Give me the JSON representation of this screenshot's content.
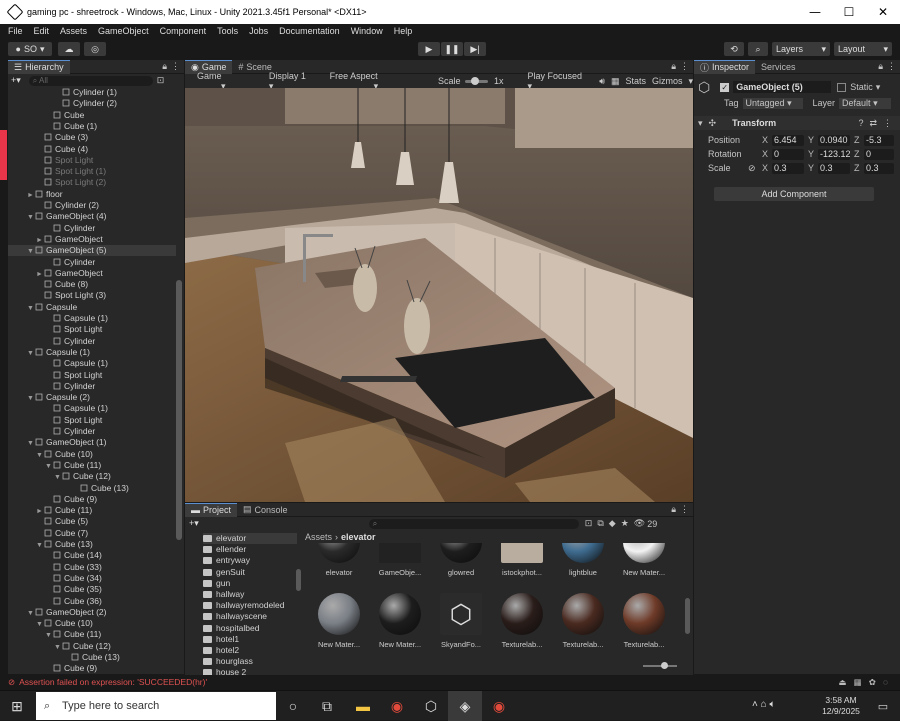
{
  "window": {
    "title": "gaming pc - shreetrock - Windows, Mac, Linux - Unity 2021.3.45f1 Personal* <DX11>",
    "min": "—",
    "max": "☐",
    "close": "✕"
  },
  "menu": [
    "File",
    "Edit",
    "Assets",
    "GameObject",
    "Component",
    "Tools",
    "Jobs",
    "Documentation",
    "Window",
    "Help"
  ],
  "toolbar": {
    "account": "SO",
    "layers": "Layers",
    "layout": "Layout"
  },
  "hierarchy": {
    "tab": "Hierarchy",
    "search_placeholder": "All",
    "rows": [
      {
        "t": "Cylinder (1)",
        "i": 5,
        "a": ""
      },
      {
        "t": "Cylinder (2)",
        "i": 5,
        "a": ""
      },
      {
        "t": "Cube",
        "i": 4,
        "a": ""
      },
      {
        "t": "Cube (1)",
        "i": 4,
        "a": ""
      },
      {
        "t": "Cube (3)",
        "i": 3,
        "a": ""
      },
      {
        "t": "Cube (4)",
        "i": 3,
        "a": ""
      },
      {
        "t": "Spot Light",
        "i": 3,
        "a": "",
        "d": 1
      },
      {
        "t": "Spot Light (1)",
        "i": 3,
        "a": "",
        "d": 1
      },
      {
        "t": "Spot Light (2)",
        "i": 3,
        "a": "",
        "d": 1
      },
      {
        "t": "floor",
        "i": 2,
        "a": "►"
      },
      {
        "t": "Cylinder (2)",
        "i": 3,
        "a": ""
      },
      {
        "t": "GameObject (4)",
        "i": 2,
        "a": "▼"
      },
      {
        "t": "Cylinder",
        "i": 4,
        "a": ""
      },
      {
        "t": "GameObject",
        "i": 3,
        "a": "►"
      },
      {
        "t": "GameObject (5)",
        "i": 2,
        "a": "▼",
        "s": 1
      },
      {
        "t": "Cylinder",
        "i": 4,
        "a": ""
      },
      {
        "t": "GameObject",
        "i": 3,
        "a": "►"
      },
      {
        "t": "Cube (8)",
        "i": 3,
        "a": ""
      },
      {
        "t": "Spot Light (3)",
        "i": 3,
        "a": ""
      },
      {
        "t": "Capsule",
        "i": 2,
        "a": "▼"
      },
      {
        "t": "Capsule (1)",
        "i": 4,
        "a": ""
      },
      {
        "t": "Spot Light",
        "i": 4,
        "a": ""
      },
      {
        "t": "Cylinder",
        "i": 4,
        "a": ""
      },
      {
        "t": "Capsule (1)",
        "i": 2,
        "a": "▼"
      },
      {
        "t": "Capsule (1)",
        "i": 4,
        "a": ""
      },
      {
        "t": "Spot Light",
        "i": 4,
        "a": ""
      },
      {
        "t": "Cylinder",
        "i": 4,
        "a": ""
      },
      {
        "t": "Capsule (2)",
        "i": 2,
        "a": "▼"
      },
      {
        "t": "Capsule (1)",
        "i": 4,
        "a": ""
      },
      {
        "t": "Spot Light",
        "i": 4,
        "a": ""
      },
      {
        "t": "Cylinder",
        "i": 4,
        "a": ""
      },
      {
        "t": "GameObject (1)",
        "i": 2,
        "a": "▼"
      },
      {
        "t": "Cube (10)",
        "i": 3,
        "a": "▼"
      },
      {
        "t": "Cube (11)",
        "i": 4,
        "a": "▼"
      },
      {
        "t": "Cube (12)",
        "i": 5,
        "a": "▼"
      },
      {
        "t": "Cube (13)",
        "i": 7,
        "a": ""
      },
      {
        "t": "Cube (9)",
        "i": 4,
        "a": ""
      },
      {
        "t": "Cube (11)",
        "i": 3,
        "a": "►"
      },
      {
        "t": "Cube (5)",
        "i": 3,
        "a": ""
      },
      {
        "t": "Cube (7)",
        "i": 3,
        "a": ""
      },
      {
        "t": "Cube (13)",
        "i": 3,
        "a": "▼"
      },
      {
        "t": "Cube (14)",
        "i": 4,
        "a": ""
      },
      {
        "t": "Cube (33)",
        "i": 4,
        "a": ""
      },
      {
        "t": "Cube (34)",
        "i": 4,
        "a": ""
      },
      {
        "t": "Cube (35)",
        "i": 4,
        "a": ""
      },
      {
        "t": "Cube (36)",
        "i": 4,
        "a": ""
      },
      {
        "t": "GameObject (2)",
        "i": 2,
        "a": "▼"
      },
      {
        "t": "Cube (10)",
        "i": 3,
        "a": "▼"
      },
      {
        "t": "Cube (11)",
        "i": 4,
        "a": "▼"
      },
      {
        "t": "Cube (12)",
        "i": 5,
        "a": "▼"
      },
      {
        "t": "Cube (13)",
        "i": 6,
        "a": ""
      },
      {
        "t": "Cube (9)",
        "i": 4,
        "a": ""
      }
    ]
  },
  "game": {
    "tabs": [
      "Game",
      "Scene"
    ],
    "mode": "Game",
    "display": "Display 1",
    "aspect": "Free Aspect",
    "scale_label": "Scale",
    "scale_value": "1x",
    "play": "Play Focused",
    "stats": "Stats",
    "gizmos": "Gizmos"
  },
  "inspector": {
    "tabs": [
      "Inspector",
      "Services"
    ],
    "name": "GameObject (5)",
    "static": "Static",
    "tag_label": "Tag",
    "tag": "Untagged",
    "layer_label": "Layer",
    "layer": "Default",
    "component": "Transform",
    "rows": [
      {
        "label": "Position",
        "x": "6.454",
        "y": "0.0940",
        "z": "-5.3"
      },
      {
        "label": "Rotation",
        "x": "0",
        "y": "-123.12",
        "z": "0"
      },
      {
        "label": "Scale",
        "x": "0.3",
        "y": "0.3",
        "z": "0.3"
      }
    ],
    "add_component": "Add Component"
  },
  "project": {
    "tabs": [
      "Project",
      "Console"
    ],
    "count": "29",
    "breadcrumb": [
      "Assets",
      "elevator"
    ],
    "folders": [
      "elevator",
      "ellender",
      "entryway",
      "genSuit",
      "gun",
      "hallway",
      "hallwayremodeled",
      "hallwayscene",
      "hospitalbed",
      "hotel1",
      "hotel2",
      "hourglass",
      "house 2"
    ],
    "assets": [
      {
        "n": "elevator",
        "c": "#2a2a2a"
      },
      {
        "n": "GameObje...",
        "c": "#222"
      },
      {
        "n": "glowred",
        "c": "#1e1e1e"
      },
      {
        "n": "istockphot...",
        "c": "#b9ada0"
      },
      {
        "n": "lightblue",
        "c": "#3f6c90"
      },
      {
        "n": "New Mater...",
        "c": "#f2f2f2"
      },
      {
        "n": "New Mater...",
        "c": "#7a7f86"
      },
      {
        "n": "New Mater...",
        "c": "#1d1d1d"
      },
      {
        "n": "SkyandFo...",
        "c": "#2b2b2b"
      },
      {
        "n": "Texturelab...",
        "c": "#2a1d1a"
      },
      {
        "n": "Texturelab...",
        "c": "#4a2a20"
      },
      {
        "n": "Texturelab...",
        "c": "#6e3a28"
      }
    ]
  },
  "status": {
    "error": "Assertion failed on expression: 'SUCCEEDED(hr)'"
  },
  "taskbar": {
    "search": "Type here to search",
    "time": "3:58 AM",
    "date": "12/9/2025"
  }
}
